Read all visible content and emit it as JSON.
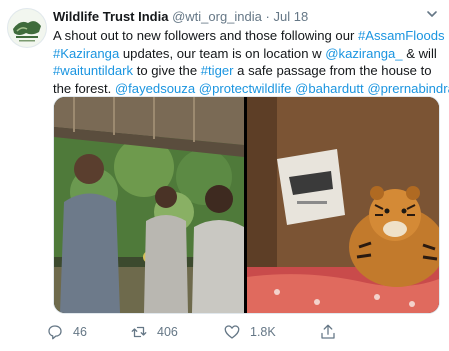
{
  "tweet": {
    "author": {
      "display_name": "Wildlife Trust India",
      "handle": "@wti_org_india",
      "separator": "·",
      "date": "Jul 18",
      "avatar_icon": "wti-logo-icon"
    },
    "body_lines": [
      [
        {
          "t": "A shout out to new followers and those following our "
        },
        {
          "t": "#AssamFloods",
          "link": true
        }
      ],
      [
        {
          "t": "#Kaziranga",
          "link": true
        },
        {
          "t": " updates, our team is on location w "
        },
        {
          "t": "@kaziranga_",
          "link": true
        },
        {
          "t": " & will"
        }
      ],
      [
        {
          "t": "#waituntildark",
          "link": true
        },
        {
          "t": " to give the "
        },
        {
          "t": "#tiger",
          "link": true
        },
        {
          "t": " a safe passage from the house to"
        }
      ],
      [
        {
          "t": "the forest. "
        },
        {
          "t": "@fayedsouza",
          "link": true
        },
        {
          "t": " "
        },
        {
          "t": "@protectwildlife",
          "link": true
        },
        {
          "t": " "
        },
        {
          "t": "@bahardutt",
          "link": true
        },
        {
          "t": " "
        },
        {
          "t": "@prernabindra",
          "link": true
        }
      ]
    ],
    "media": {
      "left_photo_desc": "team-members-photo",
      "right_photo_desc": "tiger-on-bed-photo"
    },
    "actions": {
      "reply_count": "46",
      "retweet_count": "406",
      "like_count": "1.8K",
      "reply_icon": "reply-icon",
      "retweet_icon": "retweet-icon",
      "like_icon": "heart-icon",
      "share_icon": "share-icon"
    }
  },
  "colors": {
    "text": "#14171a",
    "secondary": "#657786",
    "link": "#1b95e0",
    "border": "#e1e8ed"
  }
}
